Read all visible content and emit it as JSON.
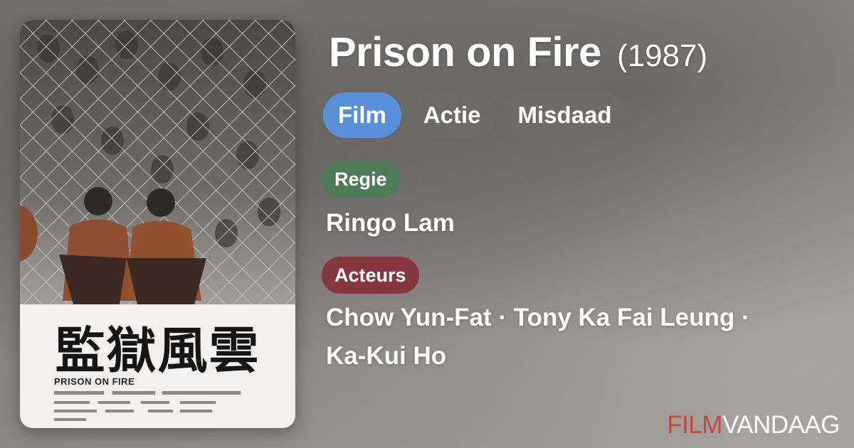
{
  "movie": {
    "title": "Prison on Fire",
    "year": "(1987)"
  },
  "genres": [
    "Film",
    "Actie",
    "Misdaad"
  ],
  "director": {
    "label": "Regie",
    "name": "Ringo Lam"
  },
  "cast": {
    "label": "Acteurs",
    "line1": "Chow Yun-Fat · Tony Ka Fai Leung ·",
    "line2": "Ka-Kui Ho"
  },
  "poster": {
    "title_zh": "監獄風雲",
    "title_en": "PRISON ON FIRE"
  },
  "brand": {
    "part1": "FILM",
    "part2": "VANDAAG"
  },
  "colors": {
    "film_pill": "#5a8fda",
    "regie_label": "#4f7a57",
    "acteurs_label": "#86363f",
    "brand_accent": "#c9473f"
  }
}
